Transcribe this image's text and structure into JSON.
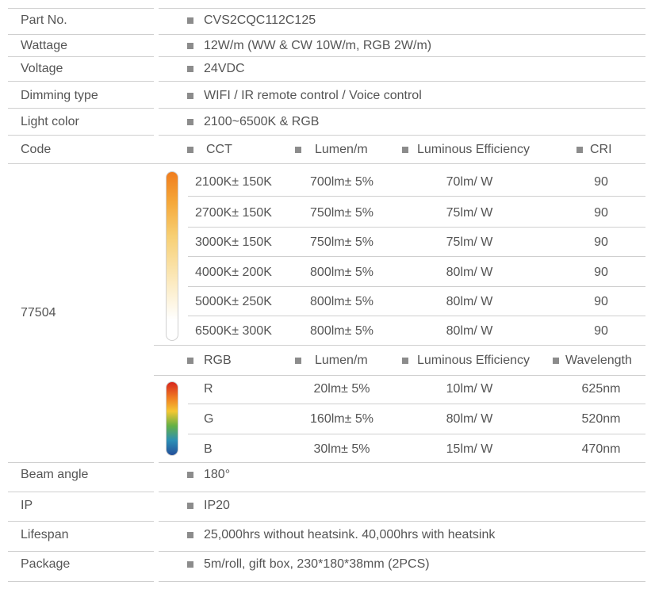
{
  "part_no": {
    "label": "Part  No.",
    "value": "CVS2CQC112C125"
  },
  "wattage": {
    "label": "Wattage",
    "value": "12W/m (WW & CW 10W/m, RGB 2W/m)"
  },
  "voltage": {
    "label": "Voltage",
    "value": "24VDC"
  },
  "dimming": {
    "label": "Dimming type",
    "value": "WIFI / IR remote control / Voice control"
  },
  "light_color": {
    "label": "Light color",
    "value": "2100~6500K & RGB"
  },
  "code": {
    "label": "Code",
    "value": "77504",
    "cct_headers": [
      "CCT",
      "Lumen/m",
      "Luminous Efficiency",
      "CRI"
    ],
    "cct_rows": [
      [
        "2100K± 150K",
        "700lm± 5%",
        "70lm/ W",
        "90"
      ],
      [
        "2700K± 150K",
        "750lm± 5%",
        "75lm/ W",
        "90"
      ],
      [
        "3000K± 150K",
        "750lm± 5%",
        "75lm/ W",
        "90"
      ],
      [
        "4000K± 200K",
        "800lm± 5%",
        "80lm/ W",
        "90"
      ],
      [
        "5000K± 250K",
        "800lm± 5%",
        "80lm/ W",
        "90"
      ],
      [
        "6500K± 300K",
        "800lm± 5%",
        "80lm/ W",
        "90"
      ]
    ],
    "rgb_headers": [
      "RGB",
      "Lumen/m",
      "Luminous Efficiency",
      "Wavelength"
    ],
    "rgb_rows": [
      [
        "R",
        "20lm± 5%",
        "10lm/ W",
        "625nm"
      ],
      [
        "G",
        "160lm± 5%",
        "80lm/ W",
        "520nm"
      ],
      [
        "B",
        "30lm± 5%",
        "15lm/ W",
        "470nm"
      ]
    ]
  },
  "beam_angle": {
    "label": "Beam angle",
    "value": "180°"
  },
  "ip": {
    "label": "IP",
    "value": "IP20"
  },
  "lifespan": {
    "label": "Lifespan",
    "value": "25,000hrs without heatsink. 40,000hrs with heatsink"
  },
  "package": {
    "label": "Package",
    "value": "5m/roll, gift box, 230*180*38mm (2PCS)"
  },
  "colors": {
    "text": "#555555",
    "rule": "#cfcfcf",
    "bullet": "#8c8c8c"
  }
}
